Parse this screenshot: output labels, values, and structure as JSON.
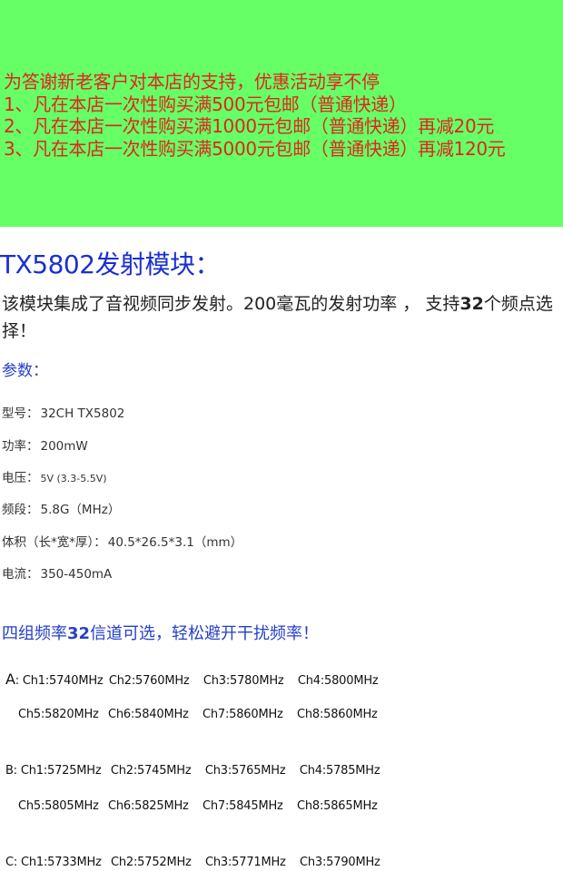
{
  "promo": {
    "line1": "为答谢新老客户对本店的支持，优惠活动享不停",
    "line2": "1、凡在本店一次性购买满500元包邮（普通快递）",
    "line3": "2、凡在本店一次性购买满1000元包邮（普通快递）再减20元",
    "line4": "3、凡在本店一次性购买满5000元包邮（普通快递）再减120元"
  },
  "title": "TX5802发射模块：",
  "desc": {
    "before": "该模块集成了音视频同步发射。200毫瓦的发射功率 ， 支持",
    "bold": "32",
    "after": "个频点选择！"
  },
  "params_heading": "参数：",
  "specs": [
    {
      "label": "型号：",
      "value": "32CH   TX5802"
    },
    {
      "label": "功率：",
      "value": "200mW"
    },
    {
      "label": "电压：",
      "value": "5V (3.3-5.5V)"
    },
    {
      "label": "频段：",
      "value": "5.8G（MHz）"
    },
    {
      "label": "体积（长*宽*厚）：",
      "value": "40.5*26.5*3.1（mm）"
    },
    {
      "label": "电流：",
      "value": "350-450mA"
    }
  ],
  "freq_heading": {
    "before": "四组频率",
    "bold": "32",
    "after": "信道可选，轻松避开干扰频率！"
  },
  "groups": {
    "A": {
      "label": "A",
      "row1": [
        "Ch1:5740MHz",
        "Ch2:5760MHz",
        "Ch3:5780MHz",
        "Ch4:5800MHz"
      ],
      "row2": [
        "Ch5:5820MHz",
        "Ch6:5840MHz",
        "Ch7:5860MHz",
        "Ch8:5860MHz"
      ]
    },
    "B": {
      "label": "B",
      "row1": [
        "Ch1:5725MHz",
        "Ch2:5745MHz",
        "Ch3:5765MHz",
        "Ch4:5785MHz"
      ],
      "row2": [
        "Ch5:5805MHz",
        "Ch6:5825MHz",
        "Ch7:5845MHz",
        "Ch8:5865MHz"
      ]
    },
    "C": {
      "label": "C",
      "row1": [
        "Ch1:5733MHz",
        "Ch2:5752MHz",
        "Ch3:5771MHz",
        "Ch3:5790MHz"
      ]
    }
  },
  "colors": {
    "banner": "#66ff66",
    "promo_text": "#e0251c",
    "title": "#1a2fd0",
    "heading": "#2640c8"
  }
}
